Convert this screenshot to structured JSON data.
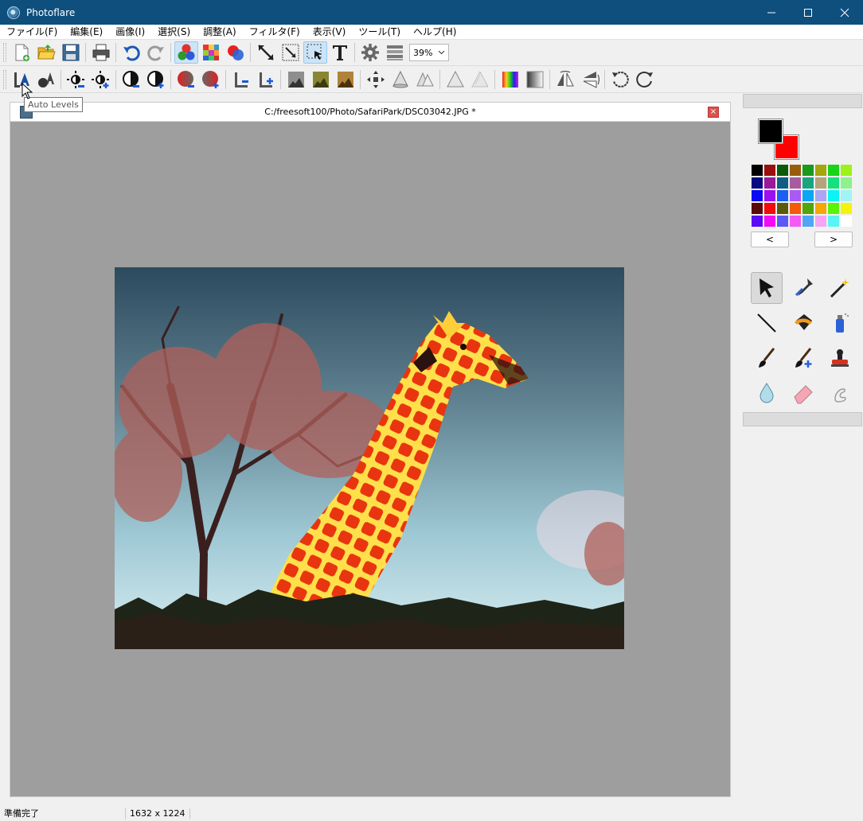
{
  "window": {
    "title": "Photoflare"
  },
  "menu": [
    "ファイル(F)",
    "編集(E)",
    "画像(I)",
    "選択(S)",
    "調整(A)",
    "フィルタ(F)",
    "表示(V)",
    "ツール(T)",
    "ヘルプ(H)"
  ],
  "toolbar": {
    "zoom_value": "39%"
  },
  "tooltip": {
    "text": "Auto Levels"
  },
  "document": {
    "title": "C:/freesoft100/Photo/SafariPark/DSC03042.JPG *",
    "close_label": "×"
  },
  "colors": {
    "titlebar": "#0e4f7d",
    "foreground": "#000000",
    "background": "#ff0000",
    "palette": [
      "#000000",
      "#9b0e0e",
      "#0a5a0a",
      "#995c0f",
      "#1a9a1a",
      "#a5a50e",
      "#18d318",
      "#9cf21a",
      "#0a0a82",
      "#9a1a9a",
      "#0f5d82",
      "#a85b9d",
      "#1aa57e",
      "#b4a47c",
      "#16e07c",
      "#8df18d",
      "#0a0af4",
      "#9a10f0",
      "#1a5ef4",
      "#aa59f2",
      "#0aa6f4",
      "#aaa6f2",
      "#0af4f4",
      "#a0f4f4",
      "#5a0a0a",
      "#f40a0a",
      "#5a5a0a",
      "#f45a0a",
      "#50a60a",
      "#f4a60a",
      "#5af40a",
      "#f4f40a",
      "#5a0af4",
      "#f40af4",
      "#5a5af4",
      "#f45af4",
      "#50a6f4",
      "#f4a6f4",
      "#5af4f4",
      "#ffffff"
    ]
  },
  "palette_nav": {
    "prev": "<",
    "next": ">"
  },
  "status": {
    "message": "準備完了",
    "dimensions": "1632 x 1224"
  }
}
